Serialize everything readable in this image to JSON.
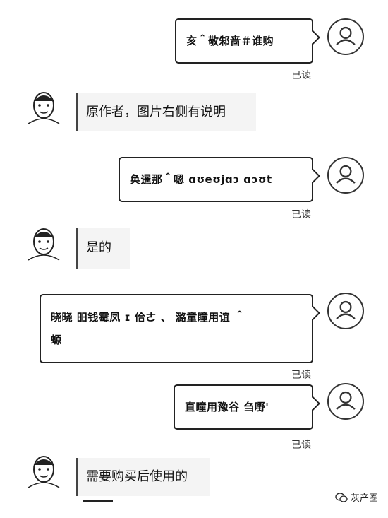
{
  "messages": {
    "m1": {
      "text": "亥＾敬邾啬＃谁购",
      "read": "已读"
    },
    "m2": {
      "text": "原作者，图片右侧有说明"
    },
    "m3": {
      "text": "奂暹那＾嗯 ɑʊeʊjɑɔ ɑɔʊt",
      "read": "已读"
    },
    "m4": {
      "text": "是的"
    },
    "m5": {
      "line1": "晓晓 昍钱霉凤 ɪ 佮ㄜ 、 潞童瞳用谊 ＾",
      "line2": "螈",
      "read": "已读"
    },
    "m6": {
      "text": "直瞳用豫谷 刍嘢'",
      "read": "已读"
    },
    "m7": {
      "text": "需要购买后使用的"
    }
  },
  "watermark": {
    "text": "灰产圈",
    "icon": "wechat-icon"
  }
}
